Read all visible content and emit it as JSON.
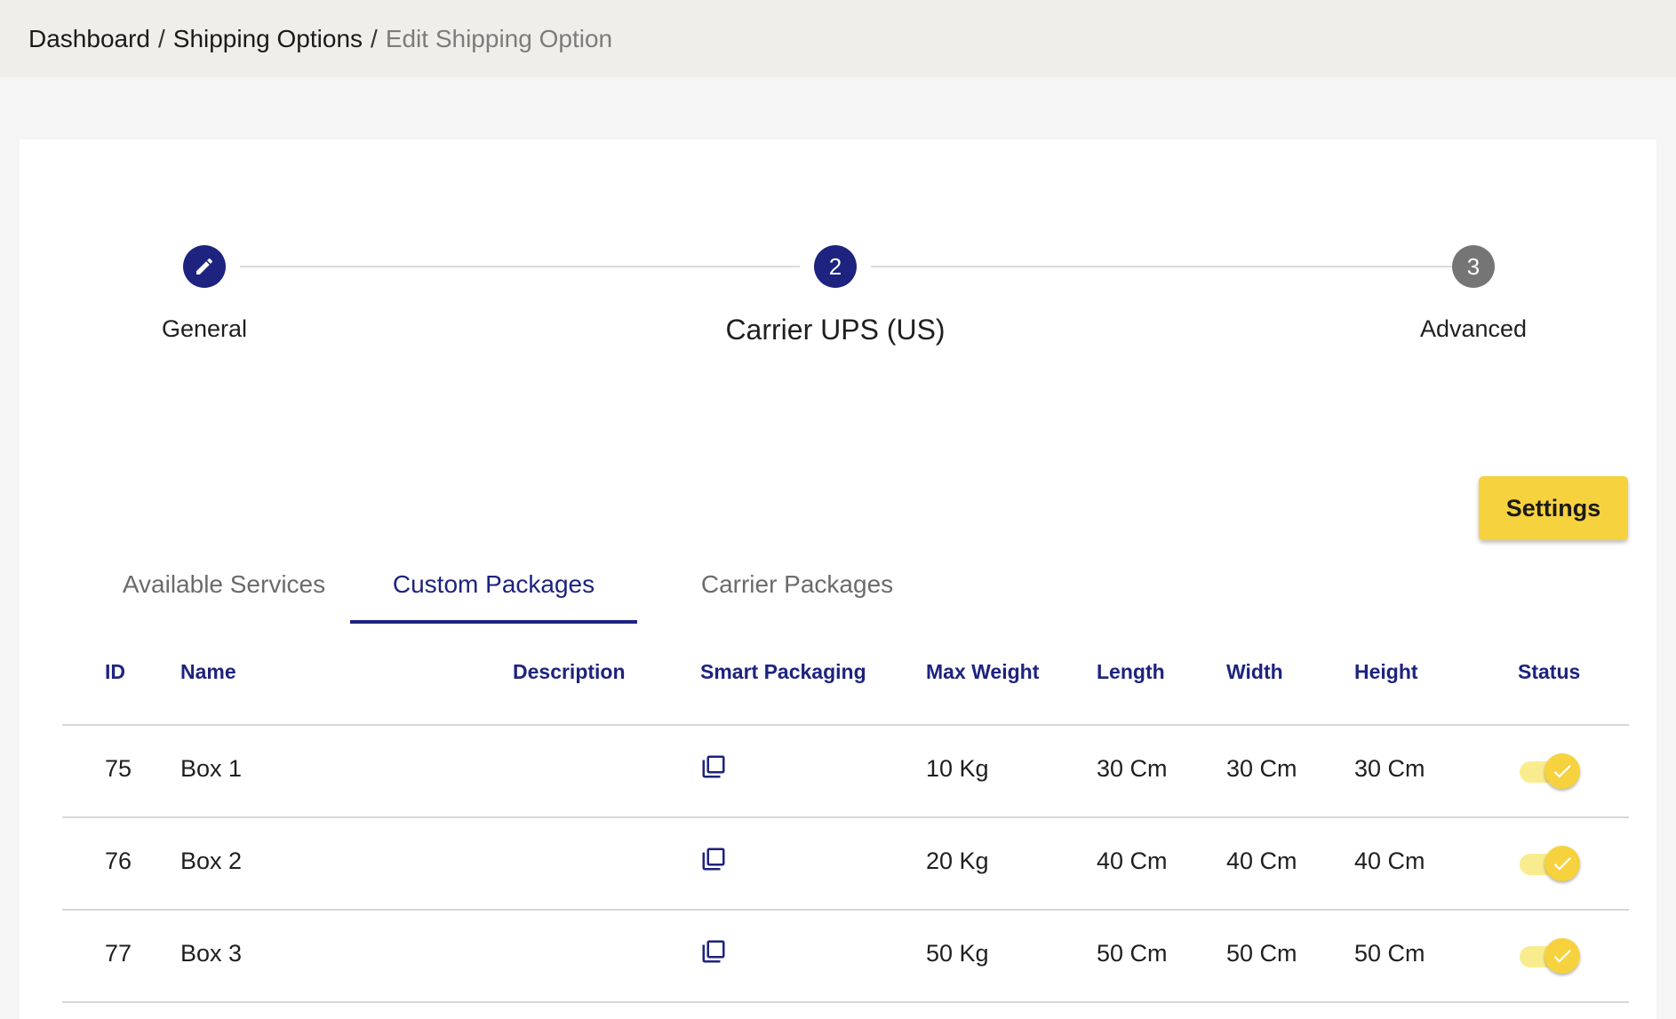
{
  "breadcrumb": {
    "items": [
      "Dashboard",
      "Shipping Options"
    ],
    "separator": "/",
    "current": "Edit Shipping Option"
  },
  "stepper": {
    "steps": [
      {
        "label": "General",
        "icon": "pencil-icon",
        "state": "completed"
      },
      {
        "label": "Carrier UPS (US)",
        "number": "2",
        "state": "active"
      },
      {
        "label": "Advanced",
        "number": "3",
        "state": "inactive"
      }
    ]
  },
  "settings_button": "Settings",
  "tabs": [
    {
      "label": "Available Services",
      "active": false
    },
    {
      "label": "Custom Packages",
      "active": true
    },
    {
      "label": "Carrier Packages",
      "active": false
    }
  ],
  "table": {
    "columns": [
      "ID",
      "Name",
      "Description",
      "Smart Packaging",
      "Max Weight",
      "Length",
      "Width",
      "Height",
      "Status"
    ],
    "rows": [
      {
        "id": "75",
        "name": "Box 1",
        "description": "",
        "smart_packaging_icon": "copy-icon",
        "max_weight": "10 Kg",
        "length": "30 Cm",
        "width": "30 Cm",
        "height": "30 Cm",
        "status": true
      },
      {
        "id": "76",
        "name": "Box 2",
        "description": "",
        "smart_packaging_icon": "copy-icon",
        "max_weight": "20 Kg",
        "length": "40 Cm",
        "width": "40 Cm",
        "height": "40 Cm",
        "status": true
      },
      {
        "id": "77",
        "name": "Box 3",
        "description": "",
        "smart_packaging_icon": "copy-icon",
        "max_weight": "50 Kg",
        "length": "50 Cm",
        "width": "50 Cm",
        "height": "50 Cm",
        "status": true
      }
    ]
  },
  "colors": {
    "primary": "#1d237e",
    "accent": "#f6d23f",
    "step_inactive": "#757575",
    "topbar": "#efeeeb"
  }
}
